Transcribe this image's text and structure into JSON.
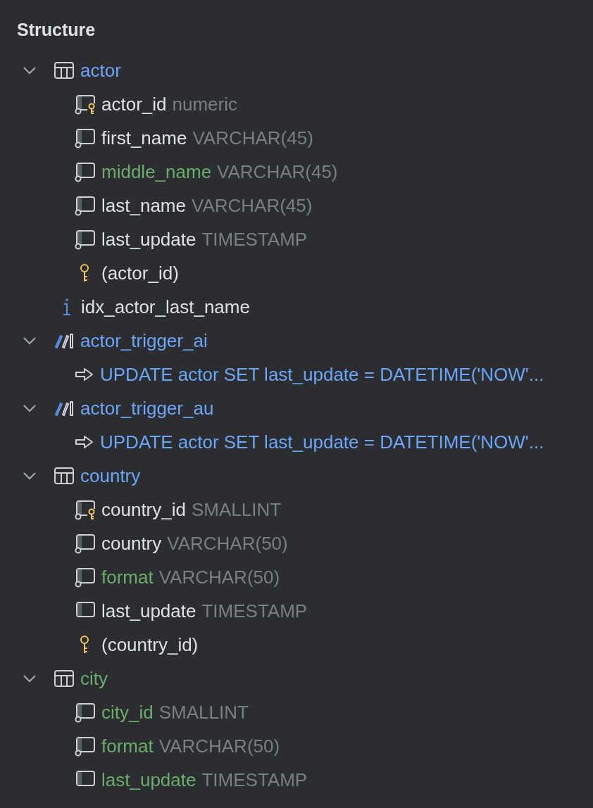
{
  "panel": {
    "title": "Structure"
  },
  "tree": [
    {
      "kind": "table",
      "name": "actor",
      "color": "#6ca6f7",
      "expanded": true,
      "children": [
        {
          "kind": "column",
          "name": "actor_id",
          "type": "numeric",
          "color": "#dfe1e5",
          "primary": true,
          "not_null": true
        },
        {
          "kind": "column",
          "name": "first_name",
          "type": "VARCHAR(45)",
          "color": "#dfe1e5",
          "primary": false,
          "not_null": true
        },
        {
          "kind": "column",
          "name": "middle_name",
          "type": "VARCHAR(45)",
          "color": "#6aae6a",
          "primary": false,
          "not_null": true
        },
        {
          "kind": "column",
          "name": "last_name",
          "type": "VARCHAR(45)",
          "color": "#dfe1e5",
          "primary": false,
          "not_null": true
        },
        {
          "kind": "column",
          "name": "last_update",
          "type": "TIMESTAMP",
          "color": "#dfe1e5",
          "primary": false,
          "not_null": true
        },
        {
          "kind": "key",
          "name": "(actor_id)",
          "color": "#dfe1e5"
        }
      ]
    },
    {
      "kind": "index",
      "name": "idx_actor_last_name",
      "color": "#dfe1e5"
    },
    {
      "kind": "trigger",
      "name": "actor_trigger_ai",
      "color": "#6ca6f7",
      "expanded": true,
      "children": [
        {
          "kind": "statement",
          "name": "UPDATE actor SET last_update = DATETIME('NOW'...",
          "color": "#6ca6f7"
        }
      ]
    },
    {
      "kind": "trigger",
      "name": "actor_trigger_au",
      "color": "#6ca6f7",
      "expanded": true,
      "children": [
        {
          "kind": "statement",
          "name": "UPDATE actor SET last_update = DATETIME('NOW'...",
          "color": "#6ca6f7"
        }
      ]
    },
    {
      "kind": "table",
      "name": "country",
      "color": "#6ca6f7",
      "expanded": true,
      "children": [
        {
          "kind": "column",
          "name": "country_id",
          "type": "SMALLINT",
          "color": "#dfe1e5",
          "primary": true,
          "not_null": true
        },
        {
          "kind": "column",
          "name": "country",
          "type": "VARCHAR(50)",
          "color": "#dfe1e5",
          "primary": false,
          "not_null": true
        },
        {
          "kind": "column",
          "name": "format",
          "type": "VARCHAR(50)",
          "color": "#6aae6a",
          "primary": false,
          "not_null": true
        },
        {
          "kind": "column",
          "name": "last_update",
          "type": "TIMESTAMP",
          "color": "#dfe1e5",
          "primary": false,
          "not_null": false
        },
        {
          "kind": "key",
          "name": "(country_id)",
          "color": "#dfe1e5"
        }
      ]
    },
    {
      "kind": "table",
      "name": "city",
      "color": "#6aae6a",
      "expanded": true,
      "children": [
        {
          "kind": "column",
          "name": "city_id",
          "type": "SMALLINT",
          "color": "#6aae6a",
          "primary": false,
          "not_null": true
        },
        {
          "kind": "column",
          "name": "format",
          "type": "VARCHAR(50)",
          "color": "#6aae6a",
          "primary": false,
          "not_null": true
        },
        {
          "kind": "column",
          "name": "last_update",
          "type": "TIMESTAMP",
          "color": "#6aae6a",
          "primary": false,
          "not_null": false
        }
      ]
    }
  ]
}
